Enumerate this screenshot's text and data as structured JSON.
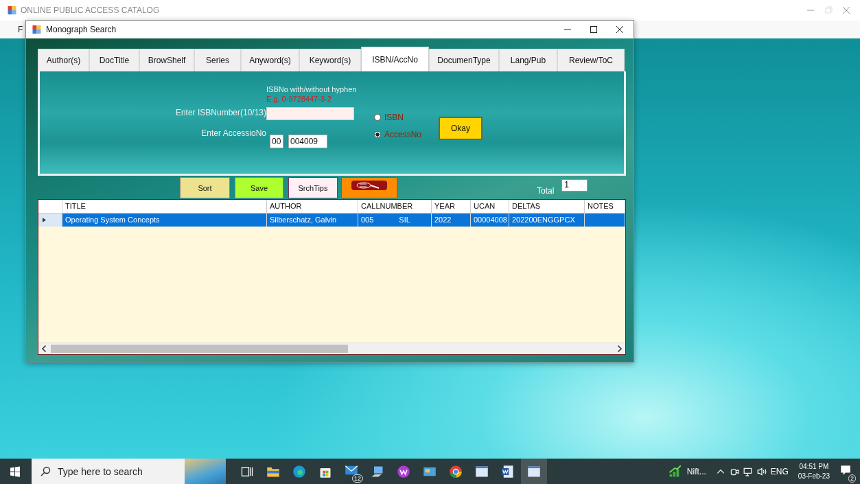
{
  "app_window": {
    "title": "ONLINE PUBLIC ACCESS CATALOG",
    "menu": [
      "F"
    ]
  },
  "dialog": {
    "title": "Monograph Search"
  },
  "tabs": [
    {
      "label": "Author(s)",
      "selected": false
    },
    {
      "label": "DocTitle",
      "selected": false
    },
    {
      "label": "BrowShelf",
      "selected": false
    },
    {
      "label": "Series",
      "selected": false
    },
    {
      "label": "Anyword(s)",
      "selected": false
    },
    {
      "label": "Keyword(s)",
      "selected": false
    },
    {
      "label": "ISBN/AccNo",
      "selected": true
    },
    {
      "label": "DocumenType",
      "selected": false
    },
    {
      "label": "Lang/Pub",
      "selected": false
    },
    {
      "label": "Review/ToC",
      "selected": false
    }
  ],
  "isbn_panel": {
    "hint": "ISBNo with/without hyphen",
    "example": "E.g. 0-9728447-3-2",
    "isbn_label": "Enter ISBNumber(10/13)",
    "accession_label": "Enter AccessioNo",
    "accession_prefix": "00",
    "accession_value": "004009",
    "options": [
      {
        "label": "ISBN",
        "selected": false
      },
      {
        "label": "AccessNo",
        "selected": true
      }
    ],
    "ok_button": "Okay"
  },
  "toolbar": {
    "buttons": [
      {
        "kind": "sort",
        "label": "Sort"
      },
      {
        "kind": "save",
        "label": "Save"
      },
      {
        "kind": "tips",
        "label": "SrchTips"
      },
      {
        "kind": "image"
      }
    ],
    "total_label": "Total",
    "total_value": "1"
  },
  "grid": {
    "columns": [
      "TITLE",
      "AUTHOR",
      "CALLNUMBER",
      "YEAR",
      "UCAN",
      "DELTAS",
      "NOTES"
    ],
    "rows": [
      {
        "selected": true,
        "title": "Operating System Concepts",
        "author": "Silberschatz, Galvin",
        "call_class": "005",
        "call_cutter": "SIL",
        "year": "2022",
        "ucan": "00004008",
        "deltas": "202200ENGGPCX"
      }
    ]
  },
  "taskbar": {
    "search_placeholder": "Type here to search",
    "mail_badge": "12",
    "widget_label": "Nift...",
    "language": "ENG",
    "time": "04:51 PM",
    "date": "03-Feb-23",
    "notification_count": "2"
  }
}
